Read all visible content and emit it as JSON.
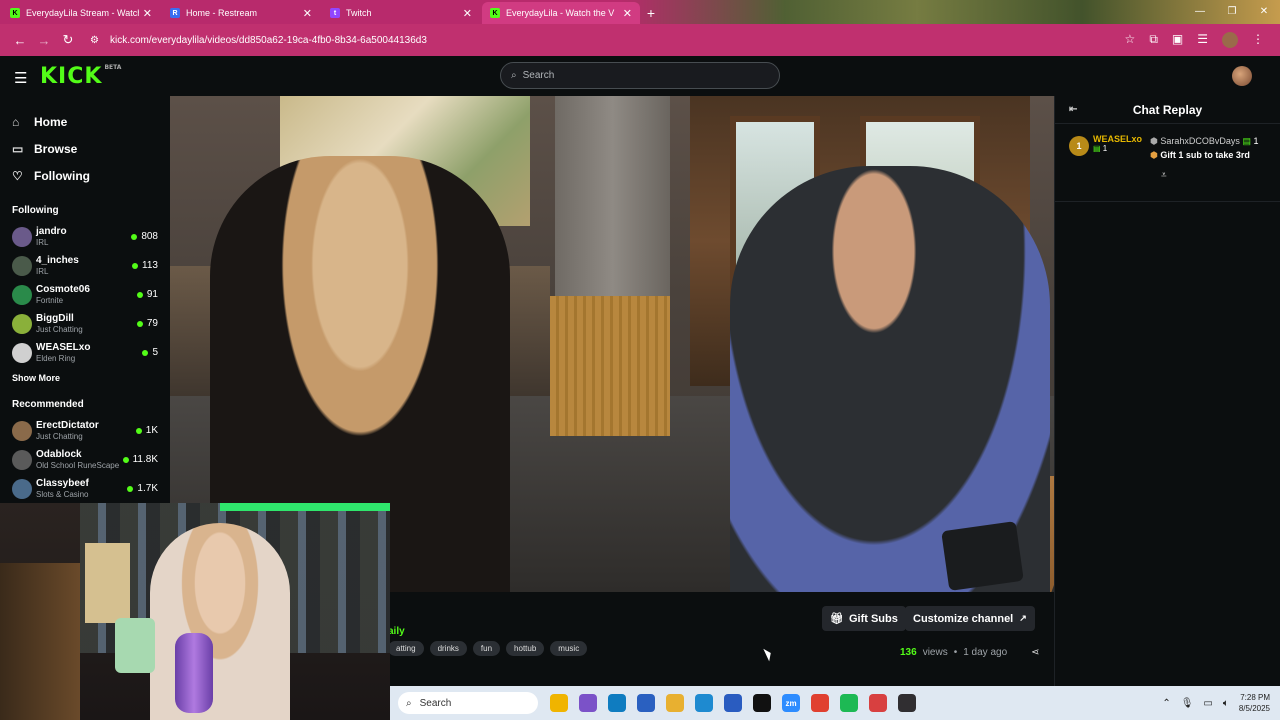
{
  "browser": {
    "tabs": [
      {
        "title": "EverydayLila Stream - Watch Li",
        "favicon": "K",
        "favicon_color": "#53fc18",
        "active": false
      },
      {
        "title": "Home - Restream",
        "favicon": "R",
        "favicon_color": "#3a6df0",
        "active": false
      },
      {
        "title": "Twitch",
        "favicon": "t",
        "favicon_color": "#9146ff",
        "active": false
      },
      {
        "title": "EverydayLila - Watch the V",
        "favicon": "K",
        "favicon_color": "#53fc18",
        "active": true
      }
    ],
    "url": "kick.com/everydaylila/videos/dd850a62-19ca-4fb0-8b34-6a50044136d3"
  },
  "header": {
    "logo": "KICK",
    "logo_badge": "BETA",
    "search_placeholder": "Search"
  },
  "sidebar": {
    "nav": [
      {
        "label": "Home",
        "icon": "home-icon",
        "glyph": "⌂"
      },
      {
        "label": "Browse",
        "icon": "browse-icon",
        "glyph": "▭"
      },
      {
        "label": "Following",
        "icon": "heart-icon",
        "glyph": "♡"
      }
    ],
    "following_title": "Following",
    "following": [
      {
        "name": "jandro",
        "category": "IRL",
        "viewers": "808",
        "color": "#6a5a8a"
      },
      {
        "name": "4_inches",
        "category": "IRL",
        "viewers": "113",
        "color": "#4a5a4a"
      },
      {
        "name": "Cosmote06",
        "category": "Fortnite",
        "viewers": "91",
        "color": "#2a8a4a"
      },
      {
        "name": "BiggDill",
        "category": "Just Chatting",
        "viewers": "79",
        "color": "#8ab03a"
      },
      {
        "name": "WEASELxo",
        "category": "Elden Ring",
        "viewers": "5",
        "color": "#d0d0d0"
      }
    ],
    "show_more": "Show More",
    "recommended_title": "Recommended",
    "recommended": [
      {
        "name": "ErectDictator",
        "category": "Just Chatting",
        "viewers": "1K",
        "color": "#8a6a4a"
      },
      {
        "name": "Odablock",
        "category": "Old School RuneScape",
        "viewers": "11.8K",
        "color": "#5a5a5a"
      },
      {
        "name": "Classybeef",
        "category": "Slots & Casino",
        "viewers": "1.7K",
        "color": "#4a6a8a"
      }
    ]
  },
  "chat": {
    "title": "Chat Replay",
    "pinned_rank": "1",
    "pinned_user": "WEASELxo",
    "pinned_count": "1",
    "gifter": "SarahxDCOBvDays",
    "gifter_count": "1",
    "gift_message": "Gift 1 sub to take 3rd"
  },
  "below": {
    "gift_subs": "Gift Subs",
    "customize": "Customize channel",
    "channel_fragment": "aily",
    "tags": [
      "atting",
      "drinks",
      "fun",
      "hottub",
      "music"
    ],
    "views": "136",
    "views_label": "views",
    "separator": "•",
    "age": "1 day ago"
  },
  "taskbar": {
    "search_placeholder": "Search",
    "time": "7:28 PM",
    "date": "8/5/2025",
    "apps": [
      {
        "name": "file-explorer",
        "color": "#f0b400",
        "glyph": ""
      },
      {
        "name": "copilot",
        "color": "#7b52c8",
        "glyph": ""
      },
      {
        "name": "edge",
        "color": "#0f7cc0",
        "glyph": ""
      },
      {
        "name": "store",
        "color": "#2a60c0",
        "glyph": ""
      },
      {
        "name": "folder",
        "color": "#e8b030",
        "glyph": ""
      },
      {
        "name": "edge-browser",
        "color": "#1e8ad0",
        "glyph": ""
      },
      {
        "name": "office",
        "color": "#2a5cc0",
        "glyph": ""
      },
      {
        "name": "capcut",
        "color": "#111111",
        "glyph": ""
      },
      {
        "name": "zoom",
        "color": "#2d8cff",
        "glyph": "zm"
      },
      {
        "name": "chrome",
        "color": "#e04030",
        "glyph": ""
      },
      {
        "name": "spotify",
        "color": "#1db954",
        "glyph": ""
      },
      {
        "name": "chrome-profile",
        "color": "#d84040",
        "glyph": ""
      },
      {
        "name": "obs",
        "color": "#302e31",
        "glyph": ""
      }
    ]
  }
}
